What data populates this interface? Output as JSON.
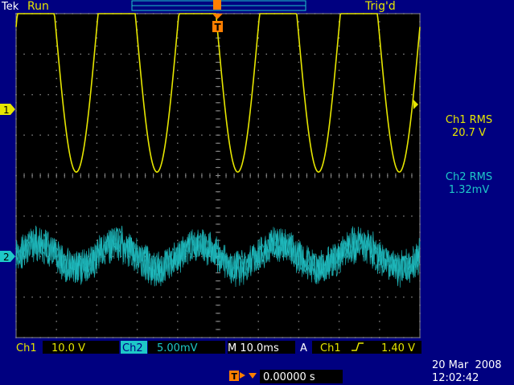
{
  "header": {
    "brand": "Tek",
    "run_state": "Run",
    "trigger_status": "Trig'd"
  },
  "measurements": [
    {
      "label": "Ch1 RMS",
      "value": "20.7 V"
    },
    {
      "label": "Ch2 RMS",
      "value": "1.32mV"
    }
  ],
  "markers": {
    "ch1": "1",
    "ch2": "2",
    "trigger": "T"
  },
  "footer": {
    "ch1_label": "Ch1",
    "ch1_scale": "10.0 V",
    "ch2_label": "Ch2",
    "ch2_scale": "5.00mV",
    "timebase": "M 10.0ms",
    "trigger_mode": "A",
    "trigger_source": "Ch1",
    "trigger_level": "1.40 V",
    "trigger_position": "0.00000 s",
    "date": "20 Mar  2008",
    "time": "12:02:42"
  },
  "colors": {
    "background": "#000080",
    "graticule_bg": "#000000",
    "ch1": "#e6e600",
    "ch2": "#1ec8c8",
    "trigger": "#ff7f00"
  },
  "waveforms": {
    "ch1": {
      "cycles_on_screen": 5,
      "shape": "sine-clipped-top",
      "visible_min_div": -1.55
    },
    "ch2": {
      "cycles_on_screen": 5,
      "shape": "noisy-sine",
      "peak_to_peak_div": 0.6
    }
  }
}
